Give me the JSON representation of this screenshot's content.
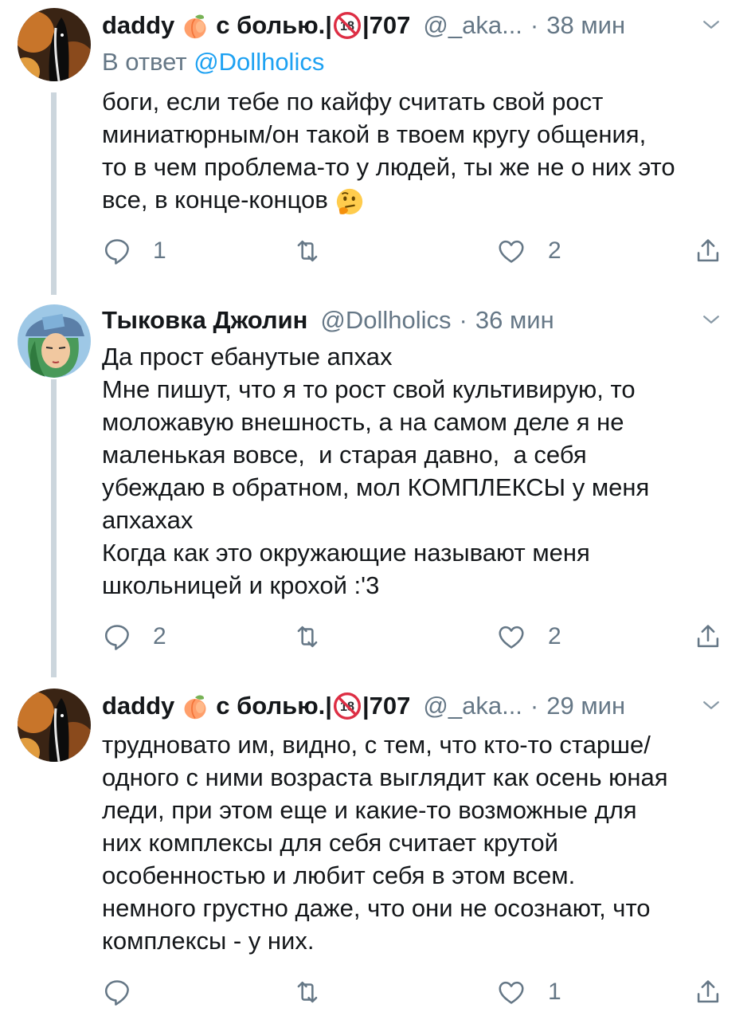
{
  "tweets": [
    {
      "name": "daddy",
      "name_suffix": "с болью.|",
      "badge": "18",
      "name_tail": "|707",
      "handle": "@_aka...",
      "dot": "·",
      "time": "38 мин",
      "reply_label": "В ответ",
      "reply_mention": "@Dollholics",
      "lines": [
        "боги, если тебе по кайфу считать свой рост",
        "миниатюрным/он такой в твоем кругу общения,",
        "то в чем проблема-то у людей, ты же не о них это",
        "все, в конце-концов"
      ],
      "replies": "1",
      "retweets": "",
      "likes": "2"
    },
    {
      "name": "Тыковка Джолин",
      "handle": "@Dollholics",
      "dot": "·",
      "time": "36 мин",
      "lines": [
        "Да прост ебанутые апхах",
        "Мне пишут, что я то рост свой культивирую, то",
        "моложавую внешность, а на самом деле я не",
        "маленькая вовсе,  и старая давно,  а себя",
        "убеждаю в обратном, мол КОМПЛЕКСЫ у меня",
        "апхахах",
        "Когда как это окружающие называют меня",
        "школьницей и крохой :'3"
      ],
      "replies": "2",
      "retweets": "",
      "likes": "2"
    },
    {
      "name": "daddy",
      "name_suffix": "с болью.|",
      "badge": "18",
      "name_tail": "|707",
      "handle": "@_aka...",
      "dot": "·",
      "time": "29 мин",
      "lines": [
        "трудновато им, видно, с тем, что кто-то старше/",
        "одного с ними возраста выглядит как осень юная",
        "леди, при этом еще и какие-то возможные для",
        "них комплексы для себя считает крутой",
        "особенностью и любит себя в этом всем.",
        "немного грустно даже, что они не осознают, что",
        "комплексы - у них."
      ],
      "replies": "",
      "retweets": "",
      "likes": "1"
    }
  ],
  "colors": {
    "text": "#14171a",
    "secondary": "#657786",
    "link": "#1da1f2",
    "thread_line": "#ccd6dd"
  },
  "icons": [
    "peach-icon",
    "no-under-18-icon",
    "thinking-face-icon",
    "reply-icon",
    "retweet-icon",
    "like-icon",
    "share-icon",
    "chevron-down-icon"
  ]
}
